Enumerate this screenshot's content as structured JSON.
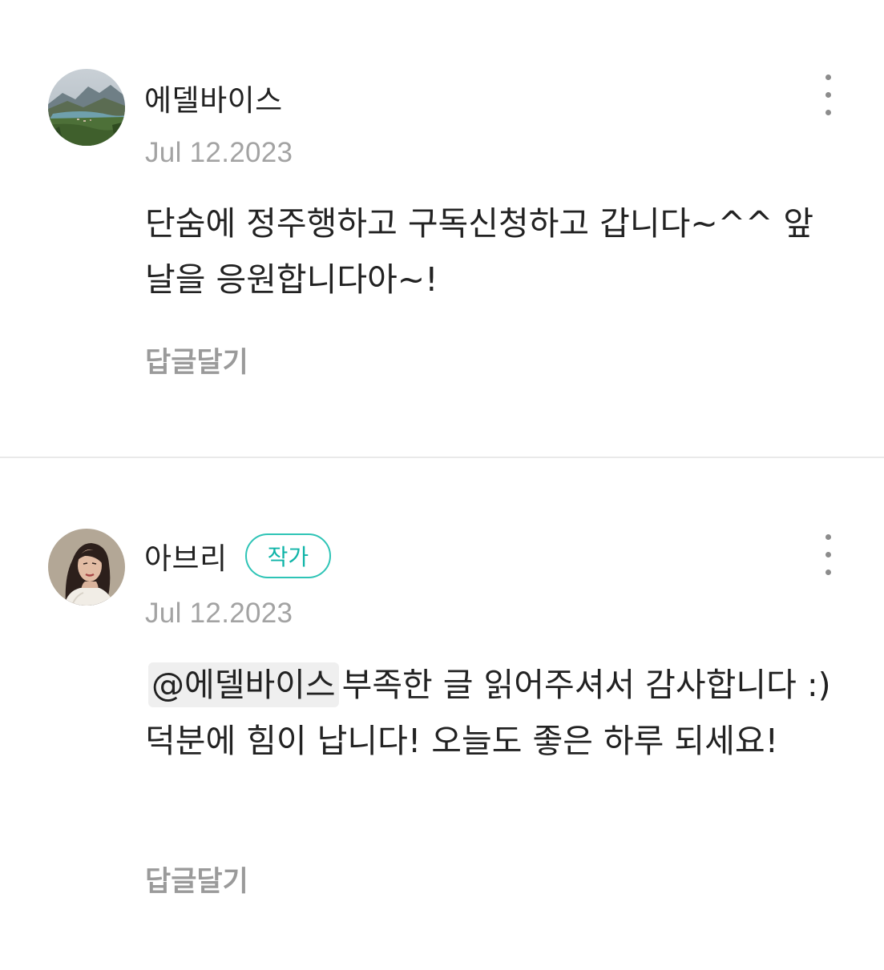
{
  "comments": [
    {
      "author": "에델바이스",
      "date": "Jul 12.2023",
      "avatar_icon": "landscape-lake-avatar",
      "body": "단숨에 정주행하고 구독신청하고 갑니다~^^ 앞날을 응원합니다아~!",
      "reply_label": "답글달기",
      "more_icon": "more-vertical-icon"
    },
    {
      "author": "아브리",
      "badge": "작가",
      "date": "Jul 12.2023",
      "avatar_icon": "illustrated-woman-avatar",
      "mention": "@에델바이스",
      "body": "부족한 글 읽어주셔서 감사합니다 :) 덕분에 힘이 납니다! 오늘도 좋은 하루 되세요!",
      "reply_label": "답글달기",
      "more_icon": "more-vertical-icon"
    }
  ],
  "colors": {
    "badge_border": "#2ec4b6",
    "badge_text": "#10b4a8",
    "date_text": "#a3a3a3",
    "reply_text": "#9a9a9a",
    "mention_bg": "#efefef",
    "divider": "#e9e9e9"
  }
}
